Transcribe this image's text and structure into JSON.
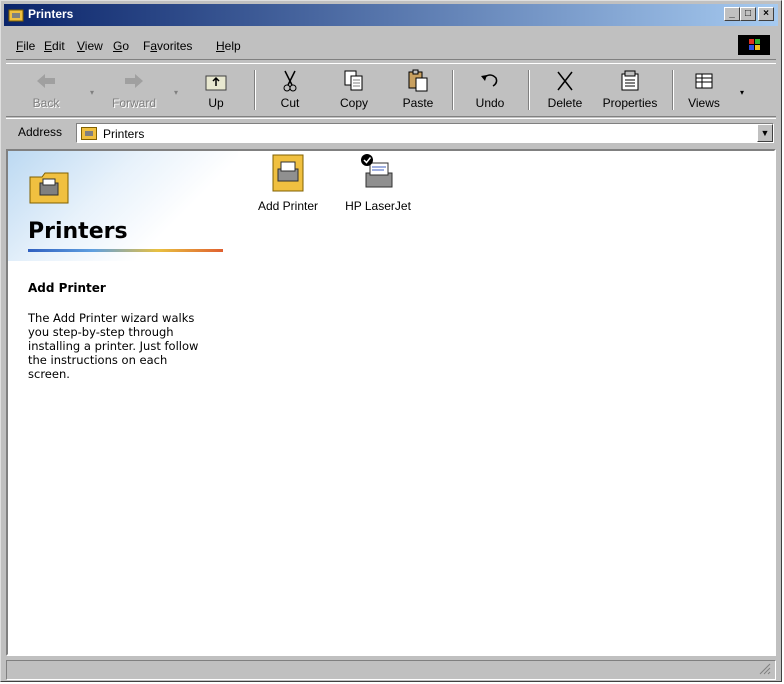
{
  "window": {
    "title": "Printers"
  },
  "menu": [
    {
      "label": "File",
      "key": "F",
      "rest": "ile"
    },
    {
      "label": "Edit",
      "key": "E",
      "rest": "dit"
    },
    {
      "label": "View",
      "key": "V",
      "rest": "iew"
    },
    {
      "label": "Go",
      "key": "G",
      "rest": "o"
    },
    {
      "label": "Favorites",
      "key": "a",
      "pre": "F",
      "rest": "vorites"
    },
    {
      "label": "Help",
      "key": "H",
      "rest": "elp"
    }
  ],
  "toolbar": {
    "back": "Back",
    "forward": "Forward",
    "up": "Up",
    "cut": "Cut",
    "copy": "Copy",
    "paste": "Paste",
    "undo": "Undo",
    "delete": "Delete",
    "properties": "Properties",
    "views": "Views"
  },
  "address": {
    "label": "Address",
    "value": "Printers"
  },
  "sidebar": {
    "title": "Printers",
    "subtitle": "Add Printer",
    "description": "The Add Printer wizard walks you step-by-step through installing a printer. Just follow the instructions on each screen."
  },
  "items": [
    {
      "label": "Add Printer",
      "icon": "add-printer-icon"
    },
    {
      "label": "HP LaserJet",
      "icon": "default-printer-icon"
    }
  ]
}
